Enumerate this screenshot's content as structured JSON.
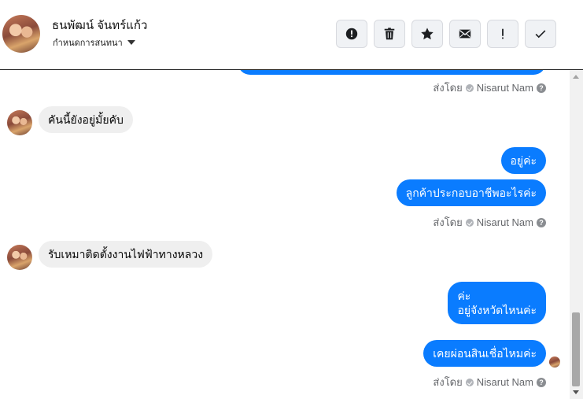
{
  "header": {
    "contact_name": "ธนพัฒน์ จันทร์แก้ว",
    "subtitle": "กำหนดการสนทนา",
    "toolbar": {
      "icons": [
        "alert-circle-icon",
        "trash-icon",
        "star-icon",
        "envelope-icon",
        "exclamation-icon",
        "check-icon"
      ]
    }
  },
  "messages": {
    "sent_by_label": "ส่งโดย",
    "agent_name": "Nisarut Nam",
    "help_mark": "?",
    "in_1": "คันนี้ยังอยู่มั้ยคับ",
    "out_1": "อยู่ค่ะ",
    "out_2": "ลูกค้าประกอบอาชีพอะไรค่ะ",
    "in_2": "รับเหมาติดตั้งงานไฟฟ้าทางหลวง",
    "out_3_line1": "ค่ะ",
    "out_3_line2": "อยู่จังหวัดไหนค่ะ",
    "out_4": "เคยผ่อนสินเชื่อไหมค่ะ"
  },
  "colors": {
    "outgoing_bubble": "#0a7cff",
    "incoming_bubble": "#efefef",
    "meta_text": "#65676b"
  }
}
